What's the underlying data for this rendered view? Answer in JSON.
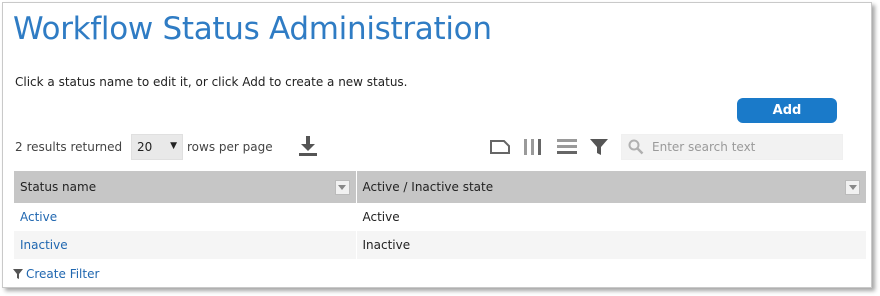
{
  "page": {
    "title": "Workflow Status Administration",
    "instructions": "Click a status name to edit it, or click Add to create a new status."
  },
  "toolbar": {
    "add_label": "Add",
    "results_text": "2 results returned",
    "rows_per_page_value": "20",
    "rows_per_page_label": "rows per page",
    "search_placeholder": "Enter search text"
  },
  "grid": {
    "columns": [
      "Status name",
      "Active / Inactive state"
    ],
    "rows": [
      {
        "name": "Active",
        "state": "Active"
      },
      {
        "name": "Inactive",
        "state": "Inactive"
      }
    ]
  },
  "footer": {
    "create_filter_label": "Create Filter"
  },
  "colors": {
    "accent": "#1a7ac9",
    "title": "#2f7cc4",
    "link": "#2067b0",
    "header_bg": "#c6c6c6"
  },
  "icons": [
    "download-icon",
    "columns-icon",
    "rows-icon",
    "list-icon",
    "filter-icon",
    "search-icon",
    "dropdown-menu-icon",
    "filter-funnel-icon"
  ]
}
